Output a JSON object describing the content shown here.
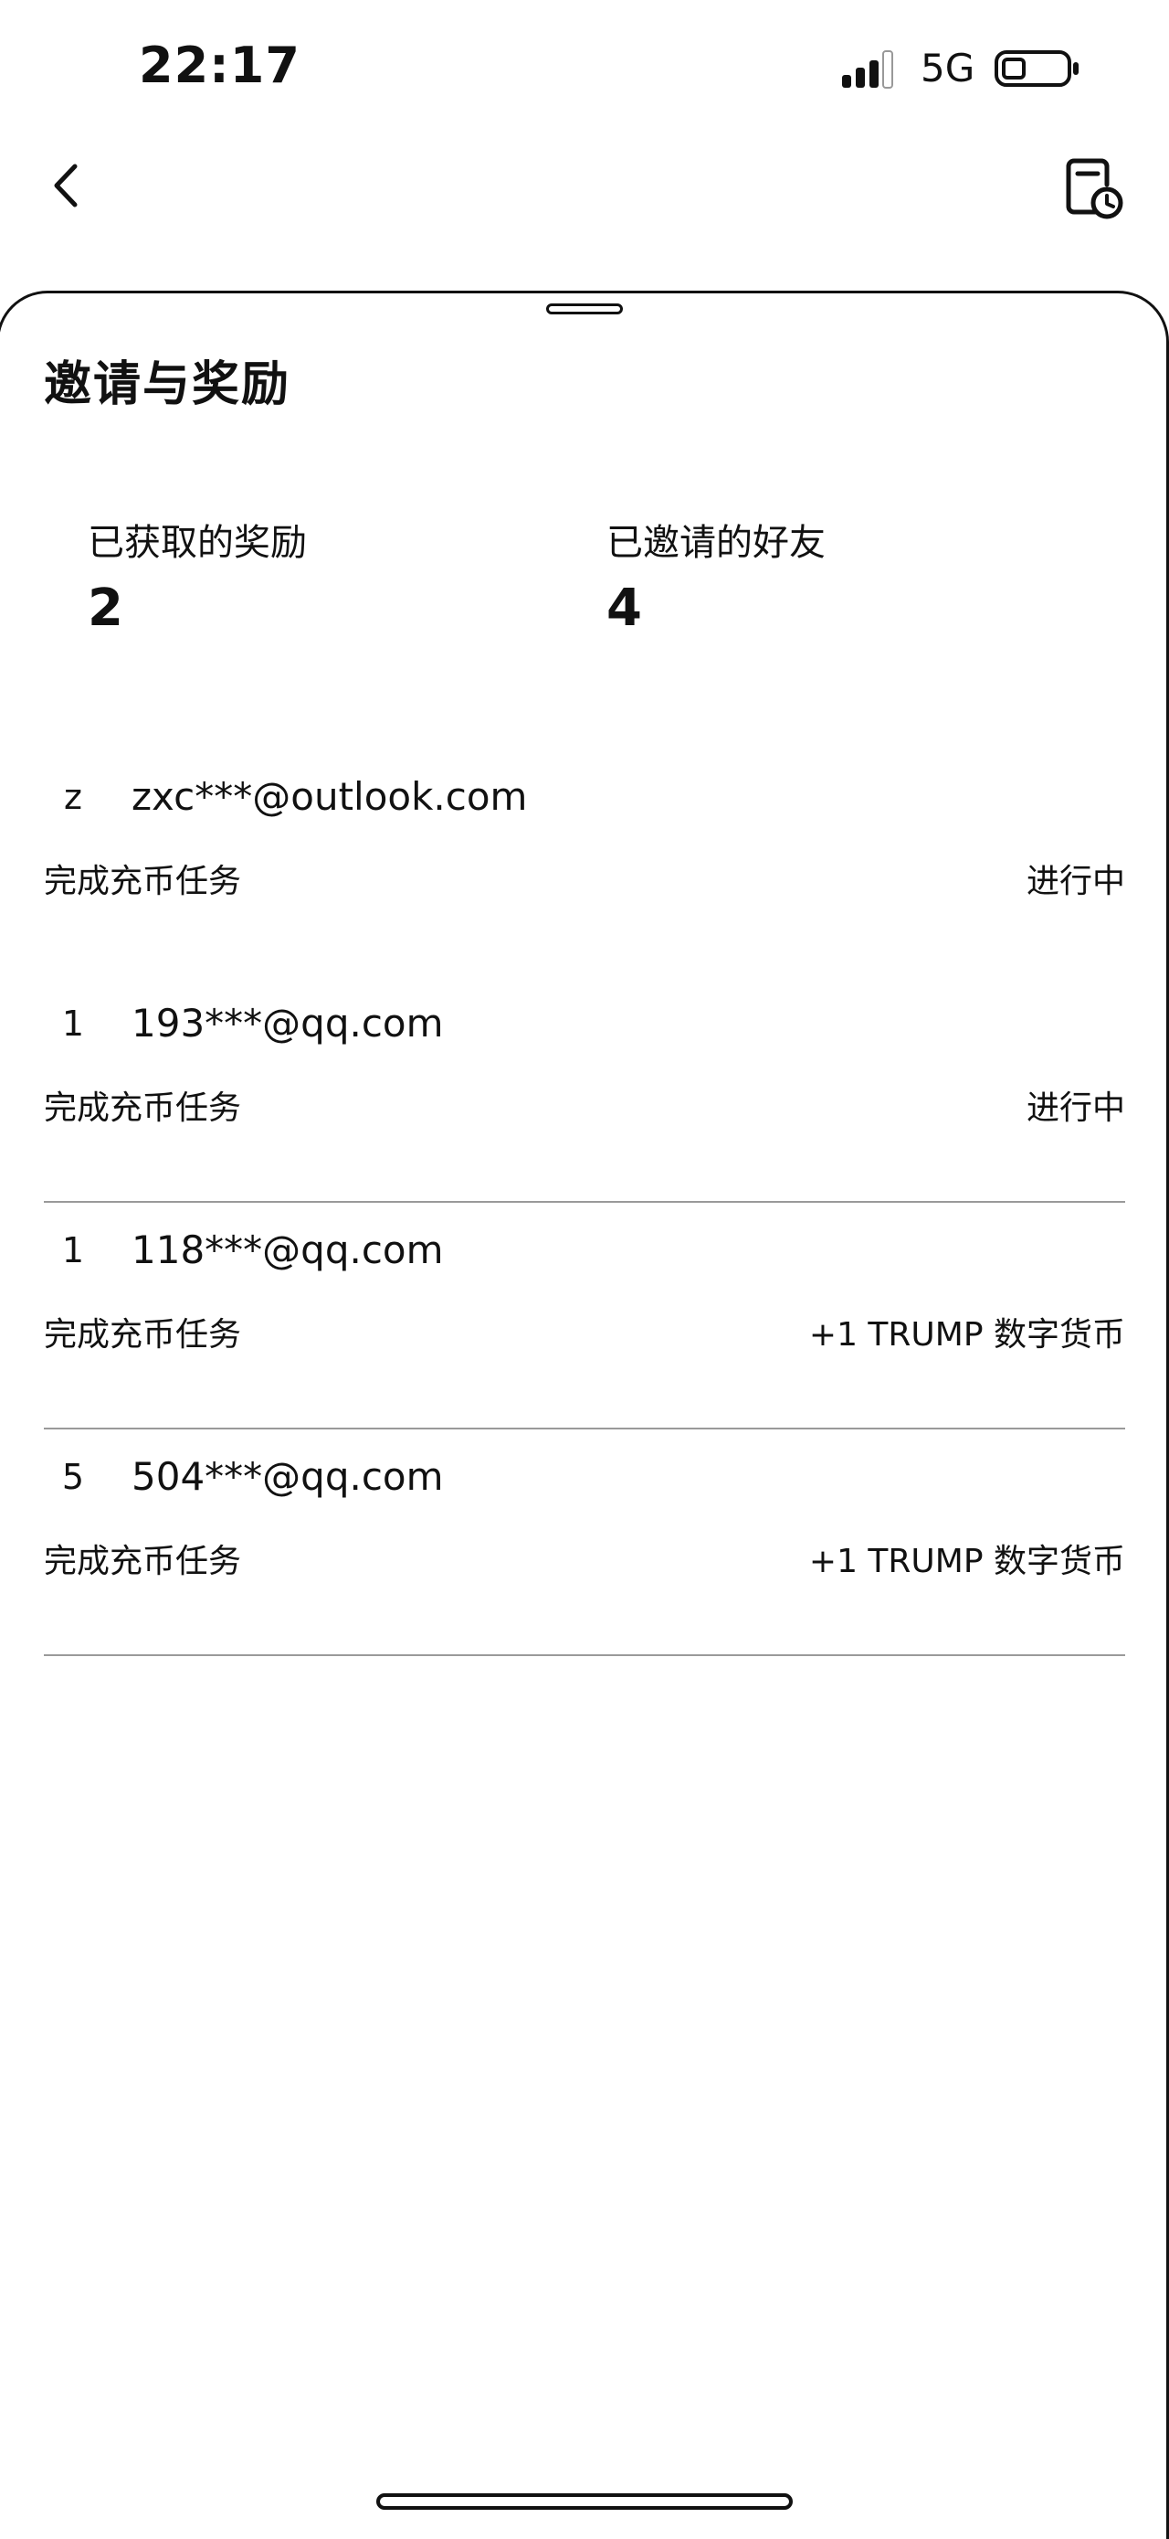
{
  "status_bar": {
    "time": "22:17",
    "network": "5G",
    "icons": [
      "signal-icon",
      "battery-icon"
    ]
  },
  "nav": {
    "icons": [
      "back-arrow-icon",
      "history-icon"
    ]
  },
  "page": {
    "title": "邀请与奖励"
  },
  "stats": {
    "rewards_label": "已获取的奖励",
    "rewards_value": "2",
    "friends_label": "已邀请的好友",
    "friends_value": "4"
  },
  "friends": [
    {
      "avatar": "z",
      "email": "zxc***@outlook.com",
      "task": "完成充币任务",
      "status": "进行中"
    },
    {
      "avatar": "1",
      "email": "193***@qq.com",
      "task": "完成充币任务",
      "status": "进行中"
    },
    {
      "avatar": "1",
      "email": "118***@qq.com",
      "task": "完成充币任务",
      "status": "+1 TRUMP 数字货币"
    },
    {
      "avatar": "5",
      "email": "504***@qq.com",
      "task": "完成充币任务",
      "status": "+1 TRUMP 数字货币"
    }
  ]
}
